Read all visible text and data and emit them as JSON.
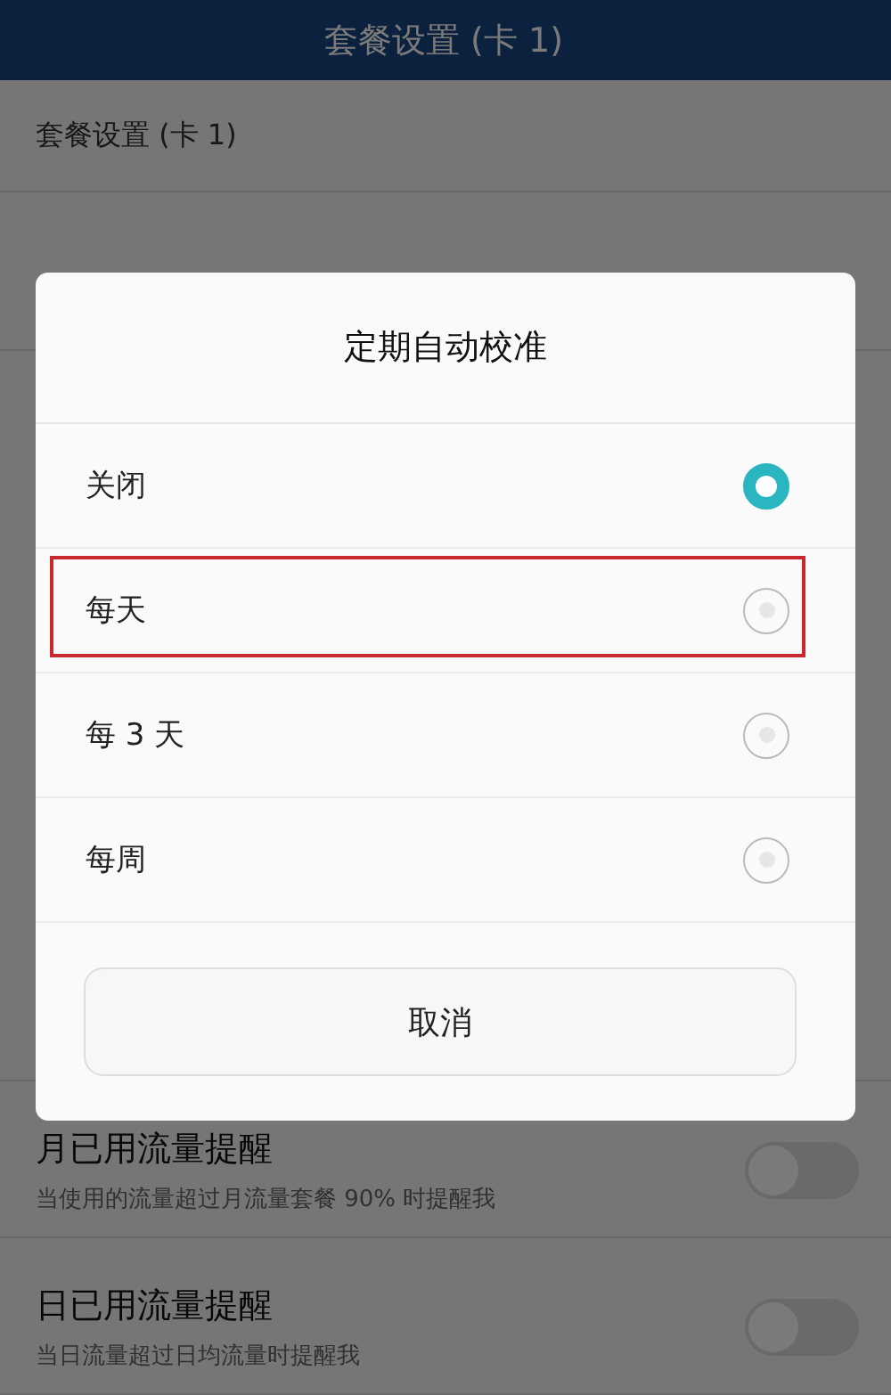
{
  "header": {
    "title": "套餐设置 (卡 1)"
  },
  "section_title": "套餐设置 (卡 1)",
  "reminders": [
    {
      "title": "月已用流量提醒",
      "subtitle": "当使用的流量超过月流量套餐 90% 时提醒我",
      "on": false
    },
    {
      "title": "日已用流量提醒",
      "subtitle": "当日流量超过日均流量时提醒我",
      "on": false
    }
  ],
  "dialog": {
    "title": "定期自动校准",
    "options": [
      {
        "label": "关闭",
        "selected": true,
        "highlighted": false
      },
      {
        "label": "每天",
        "selected": false,
        "highlighted": true
      },
      {
        "label": "每 3 天",
        "selected": false,
        "highlighted": false
      },
      {
        "label": "每周",
        "selected": false,
        "highlighted": false
      }
    ],
    "cancel": "取消"
  }
}
